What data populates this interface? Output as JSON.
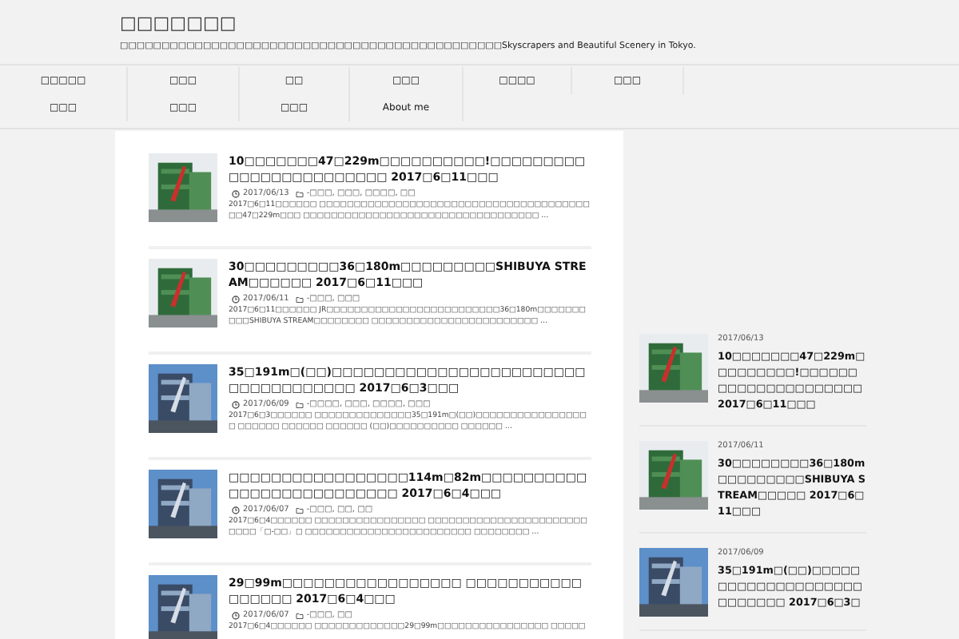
{
  "site": {
    "title": "□□□□□□□",
    "tagline": "□□□□□□□□□□□□□□□□□□□□□□□□□□□□□□□□□□□□□□□□□□□□□□Skyscrapers and Beautiful Scenery in Tokyo."
  },
  "nav": {
    "items": [
      "□□□□□",
      "□□□",
      "□□",
      "□□□",
      "□□□□",
      "□□□",
      "□□□",
      "□□□",
      "□□□",
      "About me"
    ]
  },
  "posts": [
    {
      "title": "10□□□□□□□47□229m□□□□□□□□□□!□□□□□□□□□□□□□□□□□□□□□□□□ 2017□6□11□□□",
      "date": "2017/06/13",
      "categories": "-□□□, □□□, □□□□, □□",
      "excerpt": "2017□6□11□□□□□□ □□□□□□□□□□□□□□□□□□□□□□□□□□□□□□□□□□□□□□□□□47□229m□□□ □□□□□□□□□□□□□□□□□□□□□□□□□□□□□□□□□□ …"
    },
    {
      "title": "30□□□□□□□□□36□180m□□□□□□□□□SHIBUYA STREAM□□□□□□ 2017□6□11□□□",
      "date": "2017/06/11",
      "categories": "-□□□, □□□",
      "excerpt": "2017□6□11□□□□□□ JR□□□□□□□□□□□□□□□□□□□□□□□□□36□180m□□□□□□□□□□SHIBUYA STREAM□□□□□□□□ □□□□□□□□□□□□□□□□□□□□□□□□ …"
    },
    {
      "title": "35□191m□(□□)□□□□□□□□□□□□□□□□□□□□□□□□□□□□□□□□□□□□ 2017□6□3□□□",
      "date": "2017/06/09",
      "categories": "-□□□□, □□□, □□□□, □□□",
      "excerpt": "2017□6□3□□□□□□ □□□□□□□□□□□□□□35□191m□(□□)□□□□□□□□□□□□□□□□□ □□□□□□ □□□□□□ □□□□□□ (□□)□□□□□□□□□□ □□□□□□ …"
    },
    {
      "title": "□□□□□□□□□□□□□□□□□114m□82m□□□□□□□□□□□□□□□□□□□□□□□□□□ 2017□6□4□□□",
      "date": "2017/06/07",
      "categories": "-□□□, □□, □□",
      "excerpt": "2017□6□4□□□□□□ □□□□□□□□□□□□□□□□ □□□□□□□□□□□□□□□□□□□□□□□□□□□「□-□□」□ □□□□□□□□□□□□□□□□□□□□□□□□ □□□□□□□□ …"
    },
    {
      "title": "29□99m□□□□□□□□□□□□□□□□□ □□□□□□□□□□□□□□□□□ 2017□6□4□□□",
      "date": "2017/06/07",
      "categories": "-□□□, □□",
      "excerpt": "2017□6□4□□□□□□ □□□□□□□□□□□□□29□99m□□□□□□□□□□□□□□□□ □□□□□"
    }
  ],
  "sidebar": {
    "items": [
      {
        "date": "2017/06/13",
        "title": "10□□□□□□□47□229m□□□□□□□□□!□□□□□□□□□□□□□□□□□□□□□ 2017□6□11□□□"
      },
      {
        "date": "2017/06/11",
        "title": "30□□□□□□□□36□180m□□□□□□□□□SHIBUYA STREAM□□□□□ 2017□6□11□□□"
      },
      {
        "date": "2017/06/09",
        "title": "35□191m□(□□)□□□□□□□□□□□□□□□□□□□□□□□□□□□ 2017□6□3□"
      }
    ]
  }
}
